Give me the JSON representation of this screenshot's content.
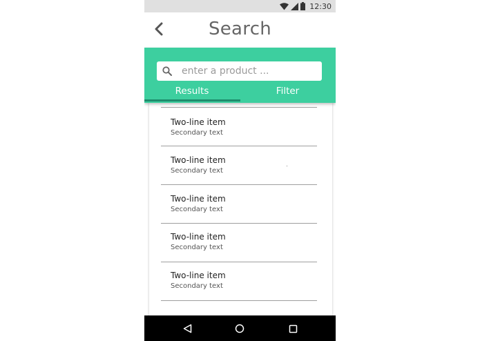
{
  "status_bar": {
    "time": "12:30",
    "icons": [
      "wifi-icon",
      "signal-icon",
      "battery-icon"
    ]
  },
  "app_bar": {
    "title": "Search",
    "back_icon": "chevron-left-icon"
  },
  "search": {
    "placeholder": "enter a product ...",
    "value": "",
    "icon": "search-icon"
  },
  "tabs": [
    {
      "label": "Results",
      "selected": true
    },
    {
      "label": "Filter",
      "selected": false
    }
  ],
  "list": {
    "items": [
      {
        "primary": "Two-line item",
        "secondary": "Secondary text"
      },
      {
        "primary": "Two-line item",
        "secondary": "Secondary text"
      },
      {
        "primary": "Two-line item",
        "secondary": "Secondary text"
      },
      {
        "primary": "Two-line item",
        "secondary": "Secondary text"
      },
      {
        "primary": "Two-line item",
        "secondary": "Secondary text"
      }
    ]
  },
  "nav_bar": {
    "buttons": [
      "back-triangle-icon",
      "home-circle-icon",
      "recents-square-icon"
    ]
  },
  "colors": {
    "accent": "#3dcf9f",
    "tab_indicator": "#1e8c6c",
    "status_bar": "#e0e0e0",
    "nav_bar": "#000000"
  }
}
